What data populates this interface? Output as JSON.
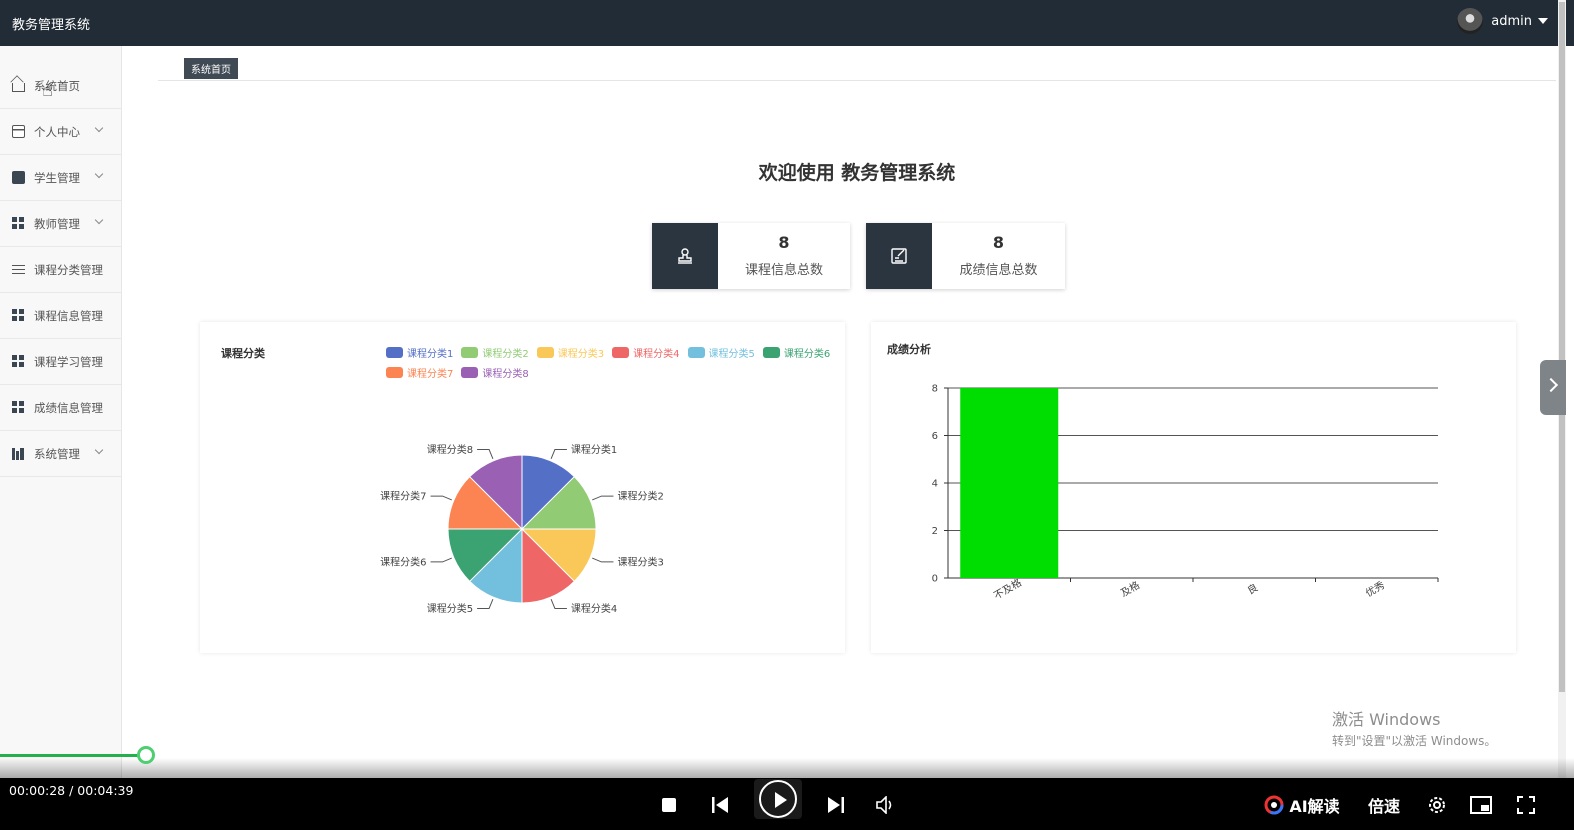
{
  "app": {
    "title": "教务管理系统"
  },
  "user": {
    "name": "admin"
  },
  "sidebar": {
    "items": [
      {
        "label": "系统首页",
        "icon": "home-icon"
      },
      {
        "label": "个人中心",
        "icon": "card-icon"
      },
      {
        "label": "学生管理",
        "icon": "clipboard-icon"
      },
      {
        "label": "教师管理",
        "icon": "grid-icon"
      },
      {
        "label": "课程分类管理",
        "icon": "sliders-icon"
      },
      {
        "label": "课程信息管理",
        "icon": "grid-icon"
      },
      {
        "label": "课程学习管理",
        "icon": "grid-icon"
      },
      {
        "label": "成绩信息管理",
        "icon": "grid-icon"
      },
      {
        "label": "系统管理",
        "icon": "bars-icon"
      }
    ]
  },
  "breadcrumb": {
    "label": "系统首页"
  },
  "welcome": "欢迎使用 教务管理系统",
  "stats": [
    {
      "value": "8",
      "label": "课程信息总数",
      "icon": "stamp-icon"
    },
    {
      "value": "8",
      "label": "成绩信息总数",
      "icon": "edit-icon"
    }
  ],
  "chart_data": [
    {
      "type": "pie",
      "title": "课程分类",
      "categories": [
        "课程分类1",
        "课程分类2",
        "课程分类3",
        "课程分类4",
        "课程分类5",
        "课程分类6",
        "课程分类7",
        "课程分类8"
      ],
      "values": [
        1,
        1,
        1,
        1,
        1,
        1,
        1,
        1
      ],
      "colors": [
        "#5470c6",
        "#91cc75",
        "#fac858",
        "#ee6666",
        "#73c0de",
        "#3ba272",
        "#fc8452",
        "#9a60b4"
      ],
      "legend": "top-right"
    },
    {
      "type": "bar",
      "title": "成绩分析",
      "categories": [
        "不及格",
        "及格",
        "良",
        "优秀"
      ],
      "values": [
        8,
        0,
        0,
        0
      ],
      "ylim": [
        0,
        8
      ],
      "yticks": [
        "0",
        "2",
        "4",
        "6",
        "8"
      ],
      "bar_color": "#00dd00",
      "grid": true
    }
  ],
  "watermark": {
    "line1": "激活 Windows",
    "line2": "转到\"设置\"以激活 Windows。"
  },
  "player": {
    "time": "00:00:28 / 00:04:39",
    "progress": 0.1,
    "ai_label": "AI解读",
    "speed_label": "倍速"
  }
}
